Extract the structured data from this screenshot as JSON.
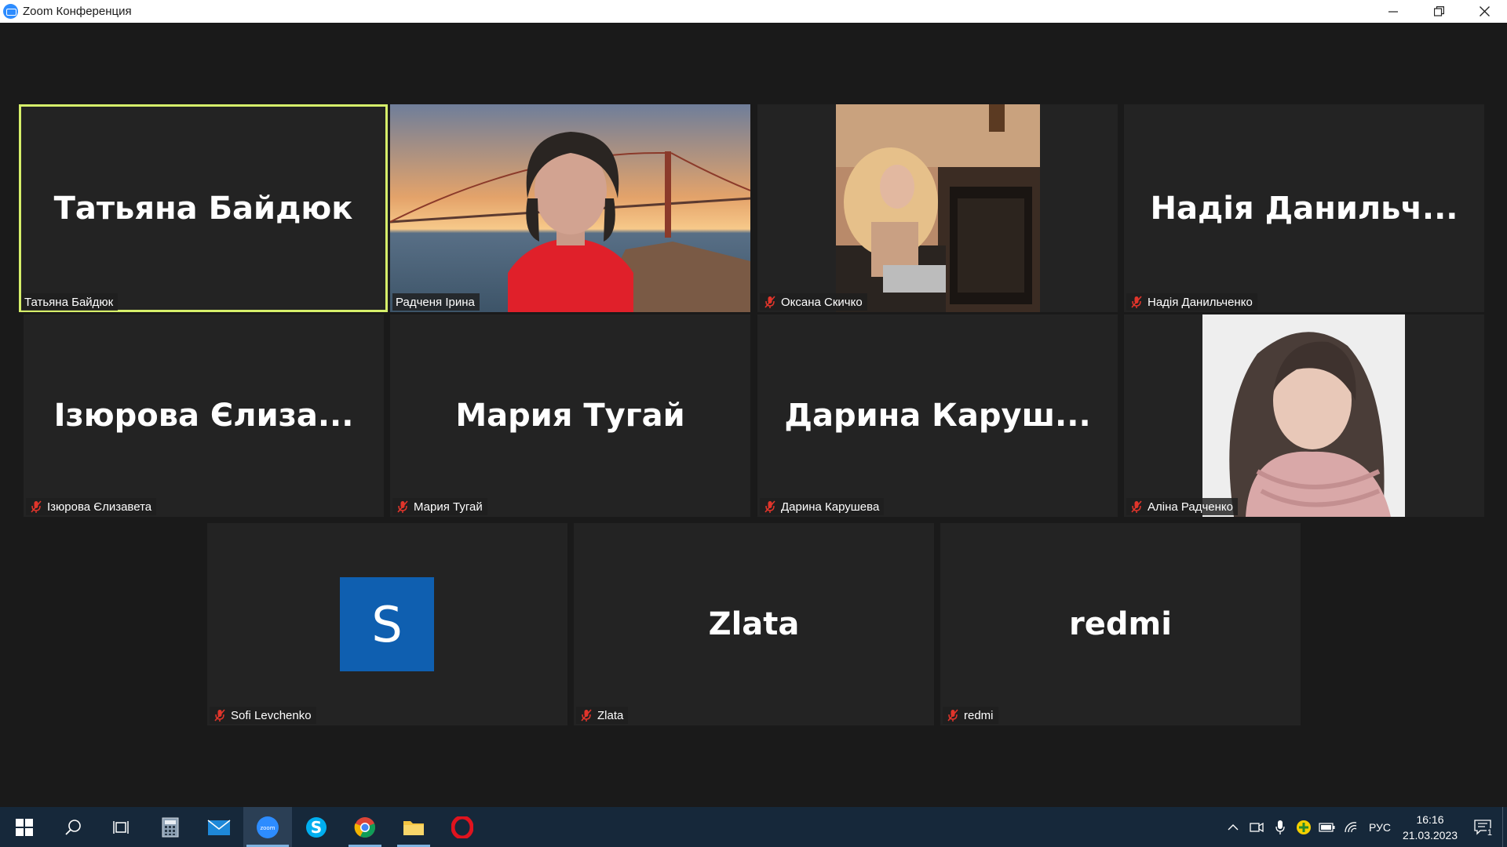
{
  "window": {
    "title": "Zoom Конференция"
  },
  "colors": {
    "background": "#1a1a1a",
    "tile": "#232323",
    "active_border": "#d6ef6a",
    "mute": "#e0352b",
    "avatar_s": "#0f5fb0"
  },
  "participants": [
    {
      "name_large": "Татьяна Байдюк",
      "label": "Татьяна Байдюк",
      "muted": false,
      "active_speaker": true,
      "has_video": false
    },
    {
      "name_large": "",
      "label": "Радченя Ірина",
      "muted": false,
      "active_speaker": false,
      "has_video": true,
      "video_desc": "webcam"
    },
    {
      "name_large": "",
      "label": "Оксана Скичко",
      "muted": true,
      "active_speaker": false,
      "has_video": true
    },
    {
      "name_large": "Надія  Данильч...",
      "label": "Надія Данильченко",
      "muted": true,
      "active_speaker": false,
      "has_video": false
    },
    {
      "name_large": "Ізюрова Єлиза...",
      "label": "Ізюрова Єлизавета",
      "muted": true,
      "active_speaker": false,
      "has_video": false
    },
    {
      "name_large": "Мария Тугай",
      "label": "Мария Тугай",
      "muted": true,
      "active_speaker": false,
      "has_video": false
    },
    {
      "name_large": "Дарина  Каруш...",
      "label": "Дарина Карушева",
      "muted": true,
      "active_speaker": false,
      "has_video": false
    },
    {
      "name_large": "",
      "label": "Аліна Радченко",
      "muted": true,
      "active_speaker": false,
      "has_video": true
    },
    {
      "name_large": "",
      "avatar_letter": "S",
      "label": "Sofi Levchenko",
      "muted": true,
      "active_speaker": false,
      "has_video": false
    },
    {
      "name_large": "Zlata",
      "label": "Zlata",
      "muted": true,
      "active_speaker": false,
      "has_video": false
    },
    {
      "name_large": "redmi",
      "label": "redmi",
      "muted": true,
      "active_speaker": false,
      "has_video": false
    }
  ],
  "taskbar": {
    "apps": [
      "start-icon",
      "search-icon",
      "task-view-icon",
      "calculator-icon",
      "mail-icon",
      "zoom-icon",
      "skype-icon",
      "chrome-icon",
      "file-explorer-icon",
      "opera-icon"
    ],
    "language": "РУС",
    "time": "16:16",
    "date": "21.03.2023",
    "notification_count": "1"
  }
}
